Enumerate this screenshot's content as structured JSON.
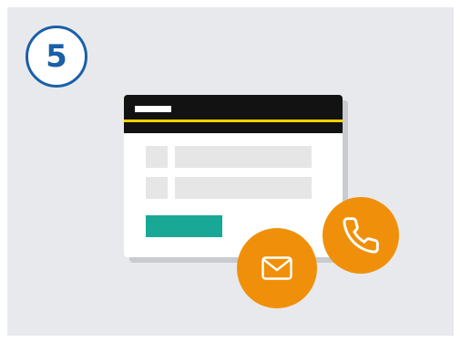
{
  "step": {
    "number": "5"
  },
  "icons": {
    "mail": "envelope-icon",
    "phone": "phone-icon"
  },
  "colors": {
    "background": "#e8e9ec",
    "badge_blue": "#1a5fa8",
    "header_black": "#121212",
    "header_accent": "#f3d100",
    "field_gray": "#e6e6e6",
    "button_teal": "#1aa896",
    "contact_orange": "#f0900a"
  }
}
